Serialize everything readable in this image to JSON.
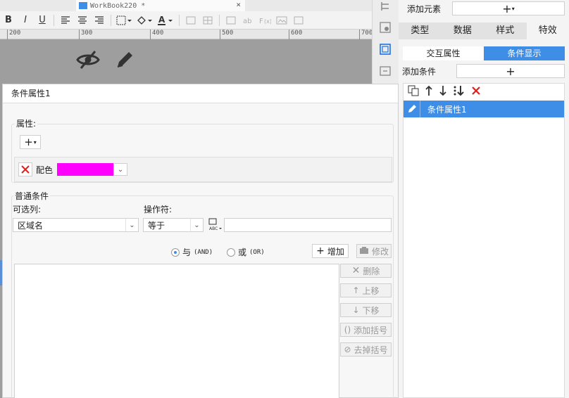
{
  "editor": {
    "doc_tab": "WorkBook220 *",
    "close_glyph": "×",
    "ruler": [
      "200",
      "300",
      "400",
      "500",
      "600",
      "700"
    ],
    "toolbar": {
      "bold": "B",
      "italic": "I",
      "underline": "U"
    }
  },
  "right_panel": {
    "add_element_label": "添加元素",
    "tabs": [
      "类型",
      "数据",
      "样式",
      "特效"
    ],
    "active_tab": "特效",
    "subtabs": [
      "交互属性",
      "条件显示"
    ],
    "active_subtab": "条件显示",
    "add_condition_label": "添加条件",
    "conditions": [
      "条件属性1"
    ]
  },
  "dialog": {
    "title": "条件属性1",
    "property_group_label": "属性:",
    "property_name": "配色",
    "property_color": "#ff00ff",
    "common_group_label": "普通条件",
    "column_label": "可选列:",
    "column_value": "区域名",
    "operator_label": "操作符:",
    "operator_value": "等于",
    "value_input": "",
    "radio_and": "与",
    "radio_and_tag": "(AND)",
    "radio_or": "或",
    "radio_or_tag": "(OR)",
    "selected_logic": "and",
    "buttons": {
      "add": "增加",
      "modify": "修改",
      "delete": "删除",
      "move_up": "上移",
      "move_down": "下移",
      "add_paren": "添加括号",
      "remove_paren": "去掉括号"
    }
  },
  "colors": {
    "accent": "#3e8ee8",
    "delete_red": "#e02020",
    "editor_gray": "#9e9e9e"
  }
}
